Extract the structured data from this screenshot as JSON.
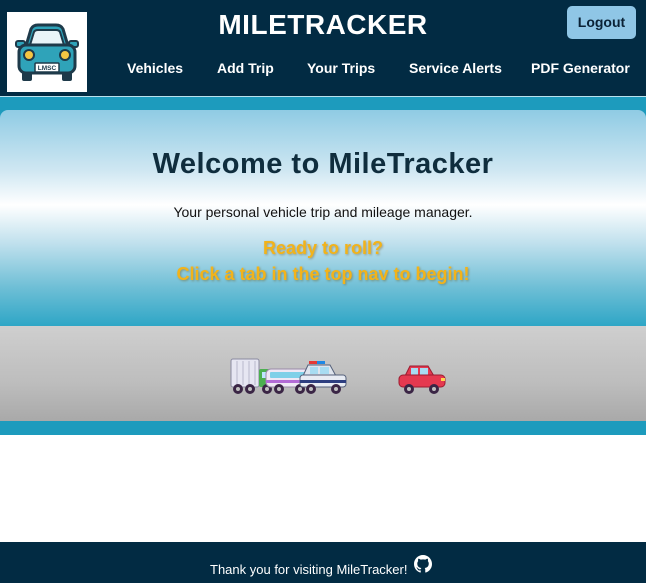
{
  "app": {
    "title": "MILETRACKER",
    "logo_plate": "LMSC"
  },
  "header": {
    "logout_label": "Logout",
    "nav": [
      "Vehicles",
      "Add Trip",
      "Your Trips",
      "Service Alerts",
      "PDF Generator"
    ]
  },
  "hero": {
    "title": "Welcome to MileTracker",
    "subtitle": "Your personal vehicle trip and mileage manager.",
    "cta_line1": "Ready to roll?",
    "cta_line2": "Click a tab in the top nav to begin!"
  },
  "vehicles_graphic": {
    "icons": [
      "truck-icon",
      "bus-icon",
      "police-car-icon",
      "red-car-icon"
    ]
  },
  "footer": {
    "text": "Thank you for visiting MileTracker!",
    "icon": "github-icon"
  },
  "colors": {
    "header_bg": "#022b43",
    "accent": "#1d9bbd",
    "cta": "#f2b31a",
    "logout_bg": "#8fc6e6"
  }
}
